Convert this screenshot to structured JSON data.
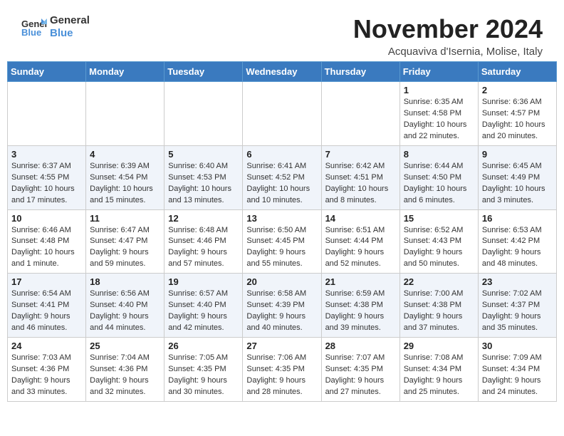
{
  "header": {
    "logo_line1": "General",
    "logo_line2": "Blue",
    "month_title": "November 2024",
    "location": "Acquaviva d'Isernia, Molise, Italy"
  },
  "weekdays": [
    "Sunday",
    "Monday",
    "Tuesday",
    "Wednesday",
    "Thursday",
    "Friday",
    "Saturday"
  ],
  "weeks": [
    [
      {
        "day": "",
        "info": ""
      },
      {
        "day": "",
        "info": ""
      },
      {
        "day": "",
        "info": ""
      },
      {
        "day": "",
        "info": ""
      },
      {
        "day": "",
        "info": ""
      },
      {
        "day": "1",
        "info": "Sunrise: 6:35 AM\nSunset: 4:58 PM\nDaylight: 10 hours and 22 minutes."
      },
      {
        "day": "2",
        "info": "Sunrise: 6:36 AM\nSunset: 4:57 PM\nDaylight: 10 hours and 20 minutes."
      }
    ],
    [
      {
        "day": "3",
        "info": "Sunrise: 6:37 AM\nSunset: 4:55 PM\nDaylight: 10 hours and 17 minutes."
      },
      {
        "day": "4",
        "info": "Sunrise: 6:39 AM\nSunset: 4:54 PM\nDaylight: 10 hours and 15 minutes."
      },
      {
        "day": "5",
        "info": "Sunrise: 6:40 AM\nSunset: 4:53 PM\nDaylight: 10 hours and 13 minutes."
      },
      {
        "day": "6",
        "info": "Sunrise: 6:41 AM\nSunset: 4:52 PM\nDaylight: 10 hours and 10 minutes."
      },
      {
        "day": "7",
        "info": "Sunrise: 6:42 AM\nSunset: 4:51 PM\nDaylight: 10 hours and 8 minutes."
      },
      {
        "day": "8",
        "info": "Sunrise: 6:44 AM\nSunset: 4:50 PM\nDaylight: 10 hours and 6 minutes."
      },
      {
        "day": "9",
        "info": "Sunrise: 6:45 AM\nSunset: 4:49 PM\nDaylight: 10 hours and 3 minutes."
      }
    ],
    [
      {
        "day": "10",
        "info": "Sunrise: 6:46 AM\nSunset: 4:48 PM\nDaylight: 10 hours and 1 minute."
      },
      {
        "day": "11",
        "info": "Sunrise: 6:47 AM\nSunset: 4:47 PM\nDaylight: 9 hours and 59 minutes."
      },
      {
        "day": "12",
        "info": "Sunrise: 6:48 AM\nSunset: 4:46 PM\nDaylight: 9 hours and 57 minutes."
      },
      {
        "day": "13",
        "info": "Sunrise: 6:50 AM\nSunset: 4:45 PM\nDaylight: 9 hours and 55 minutes."
      },
      {
        "day": "14",
        "info": "Sunrise: 6:51 AM\nSunset: 4:44 PM\nDaylight: 9 hours and 52 minutes."
      },
      {
        "day": "15",
        "info": "Sunrise: 6:52 AM\nSunset: 4:43 PM\nDaylight: 9 hours and 50 minutes."
      },
      {
        "day": "16",
        "info": "Sunrise: 6:53 AM\nSunset: 4:42 PM\nDaylight: 9 hours and 48 minutes."
      }
    ],
    [
      {
        "day": "17",
        "info": "Sunrise: 6:54 AM\nSunset: 4:41 PM\nDaylight: 9 hours and 46 minutes."
      },
      {
        "day": "18",
        "info": "Sunrise: 6:56 AM\nSunset: 4:40 PM\nDaylight: 9 hours and 44 minutes."
      },
      {
        "day": "19",
        "info": "Sunrise: 6:57 AM\nSunset: 4:40 PM\nDaylight: 9 hours and 42 minutes."
      },
      {
        "day": "20",
        "info": "Sunrise: 6:58 AM\nSunset: 4:39 PM\nDaylight: 9 hours and 40 minutes."
      },
      {
        "day": "21",
        "info": "Sunrise: 6:59 AM\nSunset: 4:38 PM\nDaylight: 9 hours and 39 minutes."
      },
      {
        "day": "22",
        "info": "Sunrise: 7:00 AM\nSunset: 4:38 PM\nDaylight: 9 hours and 37 minutes."
      },
      {
        "day": "23",
        "info": "Sunrise: 7:02 AM\nSunset: 4:37 PM\nDaylight: 9 hours and 35 minutes."
      }
    ],
    [
      {
        "day": "24",
        "info": "Sunrise: 7:03 AM\nSunset: 4:36 PM\nDaylight: 9 hours and 33 minutes."
      },
      {
        "day": "25",
        "info": "Sunrise: 7:04 AM\nSunset: 4:36 PM\nDaylight: 9 hours and 32 minutes."
      },
      {
        "day": "26",
        "info": "Sunrise: 7:05 AM\nSunset: 4:35 PM\nDaylight: 9 hours and 30 minutes."
      },
      {
        "day": "27",
        "info": "Sunrise: 7:06 AM\nSunset: 4:35 PM\nDaylight: 9 hours and 28 minutes."
      },
      {
        "day": "28",
        "info": "Sunrise: 7:07 AM\nSunset: 4:35 PM\nDaylight: 9 hours and 27 minutes."
      },
      {
        "day": "29",
        "info": "Sunrise: 7:08 AM\nSunset: 4:34 PM\nDaylight: 9 hours and 25 minutes."
      },
      {
        "day": "30",
        "info": "Sunrise: 7:09 AM\nSunset: 4:34 PM\nDaylight: 9 hours and 24 minutes."
      }
    ]
  ]
}
